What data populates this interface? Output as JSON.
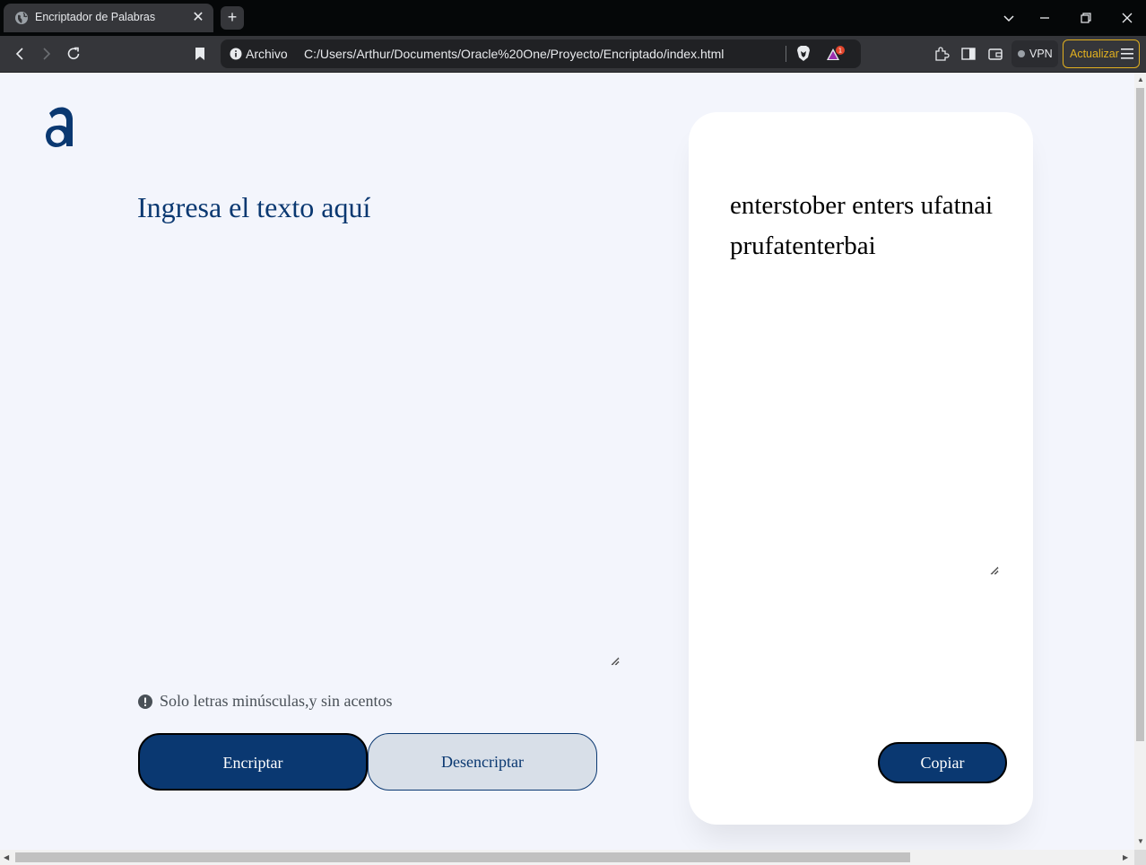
{
  "browser": {
    "tab_title": "Encriptador de Palabras",
    "new_tab_label": "+",
    "close_label": "✕",
    "address_scheme": "Archivo",
    "address_url": "C:/Users/Arthur/Documents/Oracle%20One/Proyecto/Encriptado/index.html",
    "notification_count": "1",
    "vpn_label": "VPN",
    "update_label": "Actualizar"
  },
  "page": {
    "input_placeholder": "Ingresa el texto aquí",
    "hint_text": "Solo letras minúsculas,y sin acentos",
    "encrypt_label": "Encriptar",
    "decrypt_label": "Desencriptar",
    "output_text": "enterstober enters ufatnai prufatenterbai",
    "copy_label": "Copiar"
  },
  "colors": {
    "brand": "#0a3871",
    "page_bg": "#f3f5fc",
    "secondary_btn_bg": "#d8dfe8",
    "update_accent": "#e2b01f"
  }
}
